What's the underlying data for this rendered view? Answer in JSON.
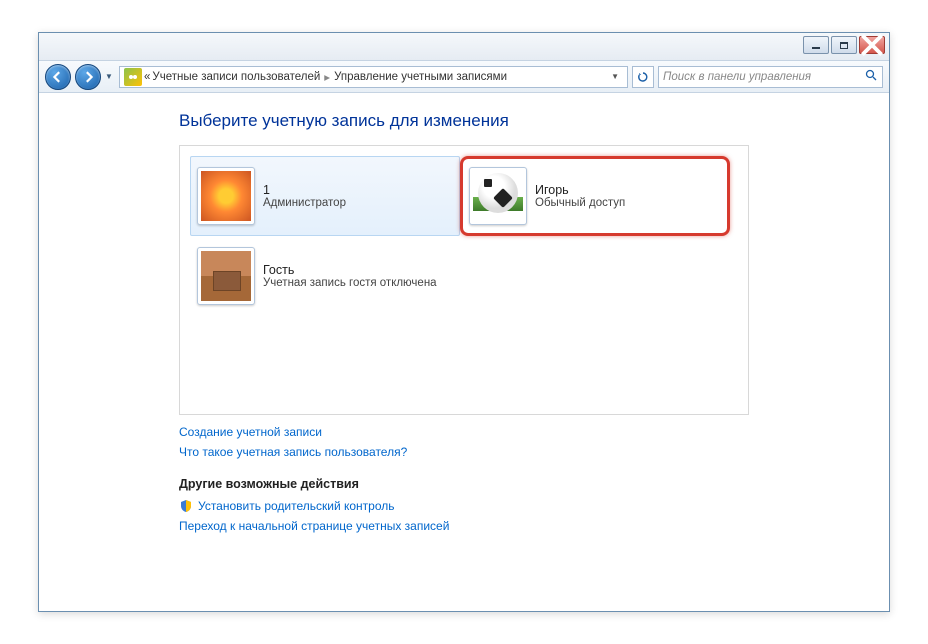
{
  "breadcrumb": {
    "prefix": "«",
    "part1": "Учетные записи пользователей",
    "part2": "Управление учетными записями"
  },
  "search": {
    "placeholder": "Поиск в панели управления"
  },
  "heading": "Выберите учетную запись для изменения",
  "accounts": [
    {
      "name": "1",
      "role": "Администратор"
    },
    {
      "name": "Игорь",
      "role": "Обычный доступ"
    },
    {
      "name": "Гость",
      "role": "Учетная запись гостя отключена"
    }
  ],
  "links": {
    "create": "Создание учетной записи",
    "what_is": "Что такое учетная запись пользователя?"
  },
  "other_section": "Другие возможные действия",
  "other_links": {
    "parental": "Установить родительский контроль",
    "home": "Переход к начальной странице учетных записей"
  }
}
